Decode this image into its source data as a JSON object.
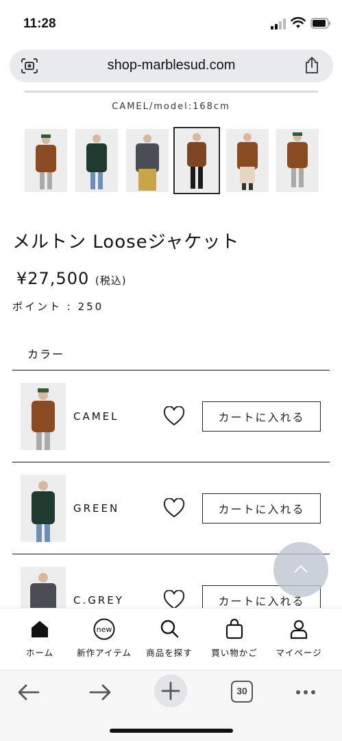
{
  "status": {
    "time": "11:28"
  },
  "browser": {
    "url": "shop-marblesud.com",
    "tab_count": "30"
  },
  "gallery": {
    "caption": "CAMEL/model:168cm",
    "selected_index": 3,
    "coat_colors": [
      "#8a4a22",
      "#1f3a2e",
      "#4a4d55",
      "#7d4620",
      "#8a4a22",
      "#8a4a22"
    ]
  },
  "product": {
    "title": "メルトン Looseジャケット",
    "price": "¥27,500",
    "tax_note": "(税込)",
    "points": "ポイント : 250",
    "color_header": "カラー"
  },
  "variants": [
    {
      "name": "CAMEL",
      "cart_label": "カートに入れる",
      "coat": "#8a4a22"
    },
    {
      "name": "GREEN",
      "cart_label": "カートに入れる",
      "coat": "#1f3a2e"
    },
    {
      "name": "C.GREY",
      "cart_label": "カートに入れる",
      "coat": "#4a4d55"
    }
  ],
  "shopnav": [
    {
      "label": "ホーム",
      "icon": "home-icon"
    },
    {
      "label": "新作アイテム",
      "icon": "new-badge-icon",
      "badge": "new"
    },
    {
      "label": "商品を探す",
      "icon": "search-icon"
    },
    {
      "label": "買い物かご",
      "icon": "shopping-bag-icon"
    },
    {
      "label": "マイページ",
      "icon": "user-icon"
    }
  ]
}
